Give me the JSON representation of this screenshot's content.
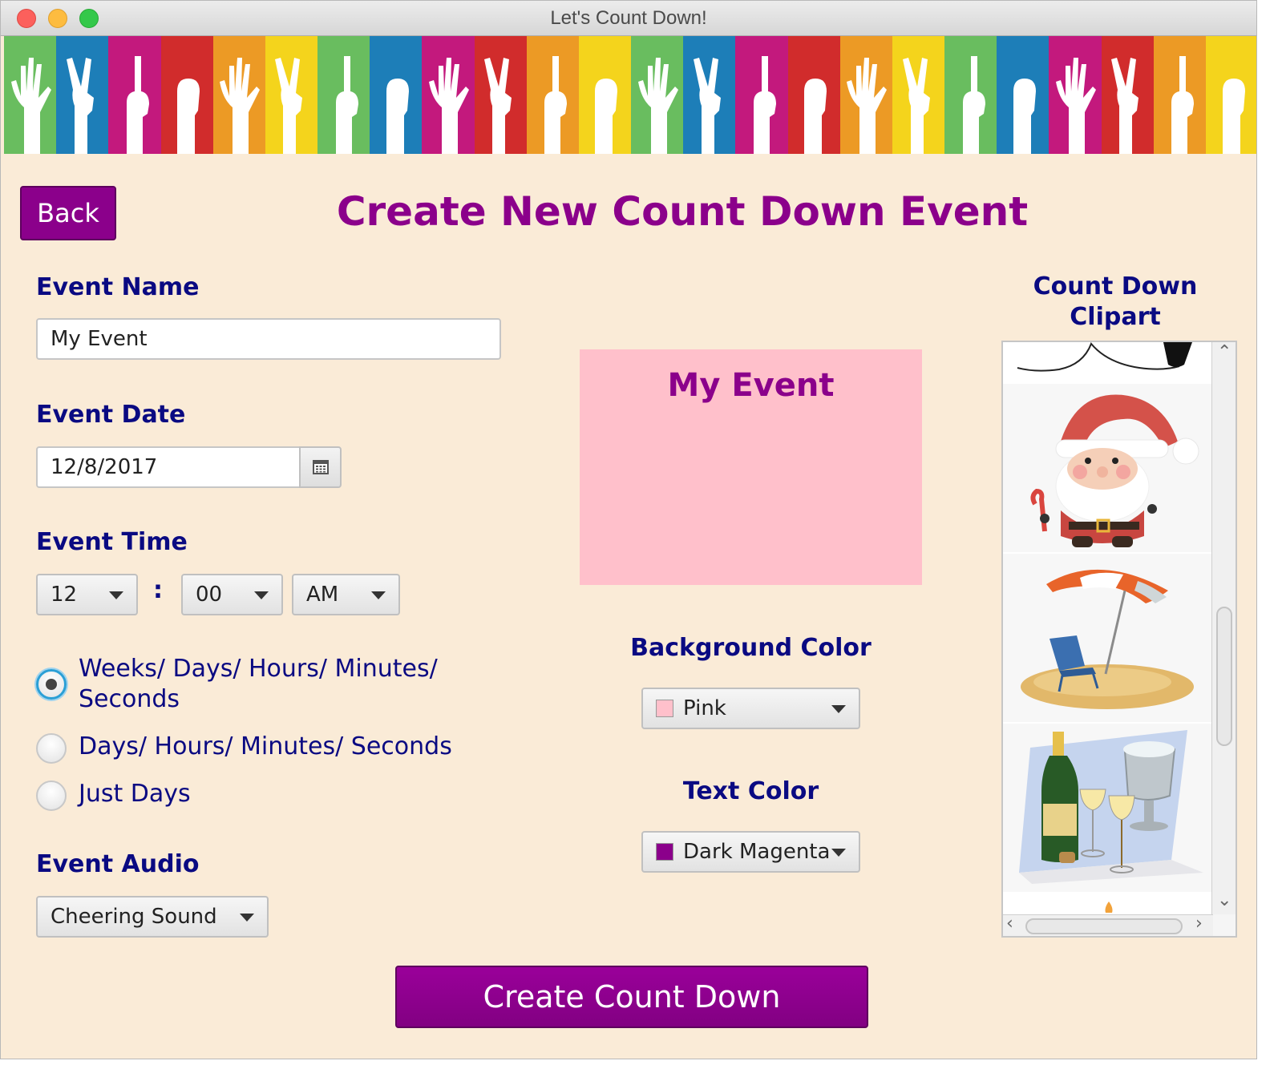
{
  "window": {
    "title": "Let's Count Down!"
  },
  "banner": {
    "stripe_colors": [
      "#69bd5f",
      "#1d7eb8",
      "#c3197d",
      "#d12c2c",
      "#ec9a25",
      "#f4d41c"
    ]
  },
  "header": {
    "back_label": "Back",
    "title": "Create New Count Down Event"
  },
  "form": {
    "event_name_label": "Event Name",
    "event_name_value": "My Event",
    "event_date_label": "Event Date",
    "event_date_value": "12/8/2017",
    "event_time_label": "Event Time",
    "hour_value": "12",
    "time_separator": ":",
    "minute_value": "00",
    "ampm_value": "AM",
    "display_options": [
      {
        "line1": "Weeks/ Days/ Hours/ Minutes/",
        "line2": "Seconds",
        "selected": true
      },
      {
        "label": "Days/ Hours/ Minutes/ Seconds",
        "selected": false
      },
      {
        "label": "Just Days",
        "selected": false
      }
    ],
    "event_audio_label": "Event Audio",
    "audio_value": "Cheering Sound"
  },
  "preview": {
    "text": "My Event",
    "background": "#ffc0cb",
    "text_color": "#8b008b"
  },
  "colors": {
    "background_label": "Background Color",
    "background_value": "Pink",
    "background_swatch": "#ffc0cb",
    "text_label": "Text Color",
    "text_value": "Dark Magenta",
    "text_swatch": "#8b008b"
  },
  "clipart": {
    "title_line1": "Count Down",
    "title_line2": "Clipart",
    "items": [
      "snow-scene-clipart",
      "santa-clipart",
      "beach-umbrella-clipart",
      "champagne-clipart",
      "candle-clipart"
    ]
  },
  "footer": {
    "create_label": "Create Count Down"
  },
  "theme": {
    "accent": "#8b008b",
    "label_color": "#0a0a82",
    "page_bg": "#faebd7"
  }
}
